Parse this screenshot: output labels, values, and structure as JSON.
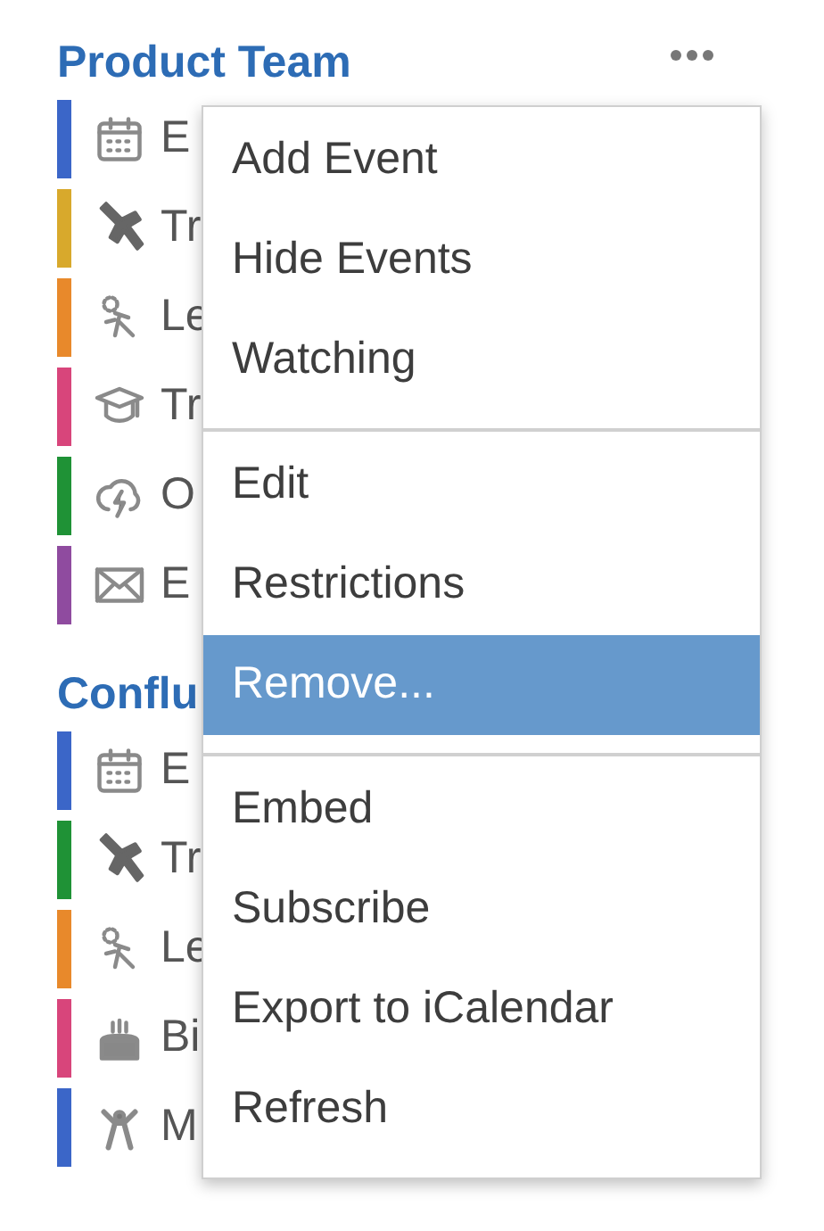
{
  "calendars": [
    {
      "title": "Product Team",
      "items": [
        {
          "label": "E",
          "kind": "event",
          "color": "#3b66c8"
        },
        {
          "label": "Tr",
          "kind": "travel",
          "color": "#d8a92c"
        },
        {
          "label": "Le",
          "kind": "leave",
          "color": "#e8892b"
        },
        {
          "label": "Tr",
          "kind": "training",
          "color": "#d8457b"
        },
        {
          "label": "O",
          "kind": "outage",
          "color": "#1f9236"
        },
        {
          "label": "E",
          "kind": "mail",
          "color": "#8f4b9f"
        }
      ]
    },
    {
      "title": "Conflu",
      "items": [
        {
          "label": "E",
          "kind": "event",
          "color": "#3b66c8"
        },
        {
          "label": "Tr",
          "kind": "travel",
          "color": "#1f9236"
        },
        {
          "label": "Le",
          "kind": "leave",
          "color": "#e8892b"
        },
        {
          "label": "Bi",
          "kind": "birthday",
          "color": "#d8457b"
        },
        {
          "label": "M",
          "kind": "launch",
          "color": "#3b66c8"
        }
      ]
    }
  ],
  "menu": {
    "groups": [
      [
        {
          "label": "Add Event",
          "selected": false
        },
        {
          "label": "Hide Events",
          "selected": false
        },
        {
          "label": "Watching",
          "selected": false
        }
      ],
      [
        {
          "label": "Edit",
          "selected": false
        },
        {
          "label": "Restrictions",
          "selected": false
        },
        {
          "label": "Remove...",
          "selected": true
        }
      ],
      [
        {
          "label": "Embed",
          "selected": false
        },
        {
          "label": "Subscribe",
          "selected": false
        },
        {
          "label": "Export to iCalendar",
          "selected": false
        },
        {
          "label": "Refresh",
          "selected": false
        }
      ]
    ]
  }
}
